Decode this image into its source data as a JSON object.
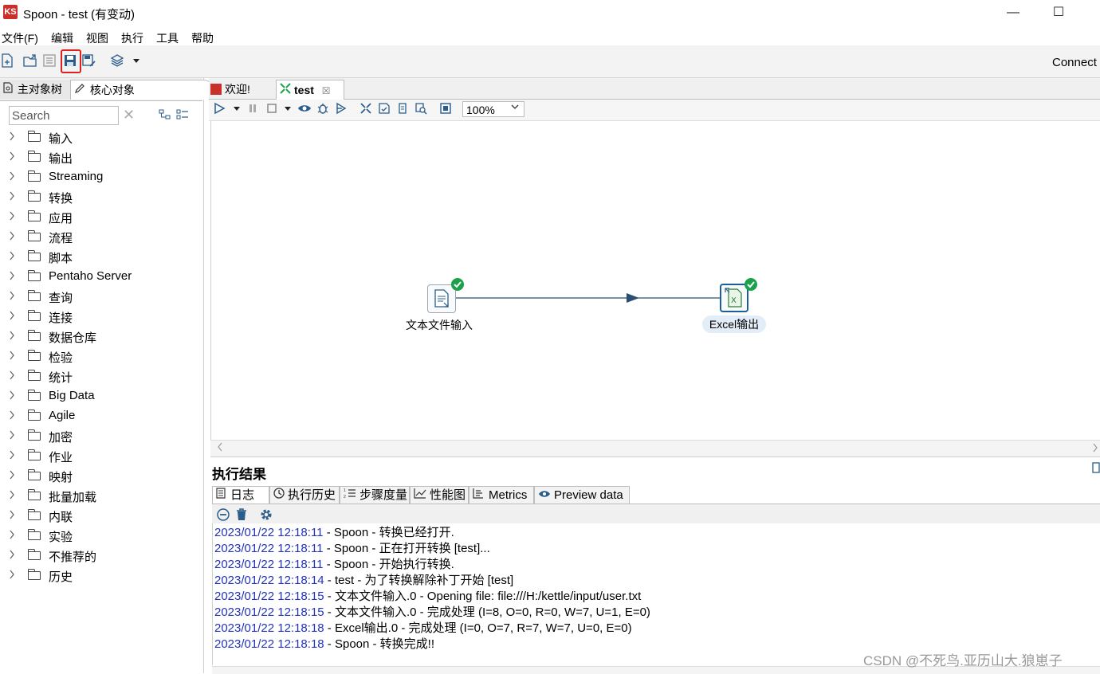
{
  "window": {
    "title": "Spoon - test (有变动)",
    "logo_text": "KS",
    "minimize": "—",
    "maximize": "☐"
  },
  "menu": [
    "文件(F)",
    "编辑",
    "视图",
    "执行",
    "工具",
    "帮助"
  ],
  "toolbar": {
    "connect_label": "Connect",
    "icons": [
      "new-file-icon",
      "open-file-icon",
      "explore-repository-icon",
      "save-icon",
      "save-as-icon",
      "perspective-layers-icon",
      "dropdown-icon"
    ]
  },
  "left_panel": {
    "tabs": [
      "主对象树",
      "核心对象"
    ],
    "search_placeholder": "Search",
    "clear_symbol": "✕",
    "tree_items": [
      "输入",
      "输出",
      "Streaming",
      "转换",
      "应用",
      "流程",
      "脚本",
      "Pentaho Server",
      "查询",
      "连接",
      "数据仓库",
      "检验",
      "统计",
      "Big Data",
      "Agile",
      "加密",
      "作业",
      "映射",
      "批量加载",
      "内联",
      "实验",
      "不推荐的",
      "历史"
    ]
  },
  "editor": {
    "tabs": [
      {
        "label": "欢迎!"
      },
      {
        "label": "test",
        "close": "☒"
      }
    ],
    "zoom": "100%",
    "steps": [
      {
        "name": "文本文件输入",
        "status": "success"
      },
      {
        "name": "Excel输出",
        "status": "success",
        "selected": true
      }
    ]
  },
  "results": {
    "title": "执行结果",
    "tabs": [
      "日志",
      "执行历史",
      "步骤度量",
      "性能图",
      "Metrics",
      "Preview data"
    ],
    "log": [
      {
        "ts": "2023/01/22 12:18:11",
        "msg": " - Spoon - 转换已经打开."
      },
      {
        "ts": "2023/01/22 12:18:11",
        "msg": " - Spoon - 正在打开转换 [test]..."
      },
      {
        "ts": "2023/01/22 12:18:11",
        "msg": " - Spoon - 开始执行转换."
      },
      {
        "ts": "2023/01/22 12:18:14",
        "msg": " - test - 为了转换解除补丁开始  [test]"
      },
      {
        "ts": "2023/01/22 12:18:15",
        "msg": " - 文本文件输入.0 - Opening file: file:///H:/kettle/input/user.txt"
      },
      {
        "ts": "2023/01/22 12:18:15",
        "msg": " - 文本文件输入.0 - 完成处理 (I=8, O=0, R=0, W=7, U=1, E=0)"
      },
      {
        "ts": "2023/01/22 12:18:18",
        "msg": " - Excel输出.0 - 完成处理 (I=0, O=7, R=7, W=7, U=0, E=0)"
      },
      {
        "ts": "2023/01/22 12:18:18",
        "msg": " - Spoon - 转换完成!!"
      }
    ]
  },
  "watermark": "CSDN @不死鸟.亚历山大.狼崽子",
  "colors": {
    "highlight_box": "#e0201c",
    "log_timestamp": "#2233bb",
    "success_badge": "#1aa14a",
    "hop_line": "#2b4f6e"
  }
}
